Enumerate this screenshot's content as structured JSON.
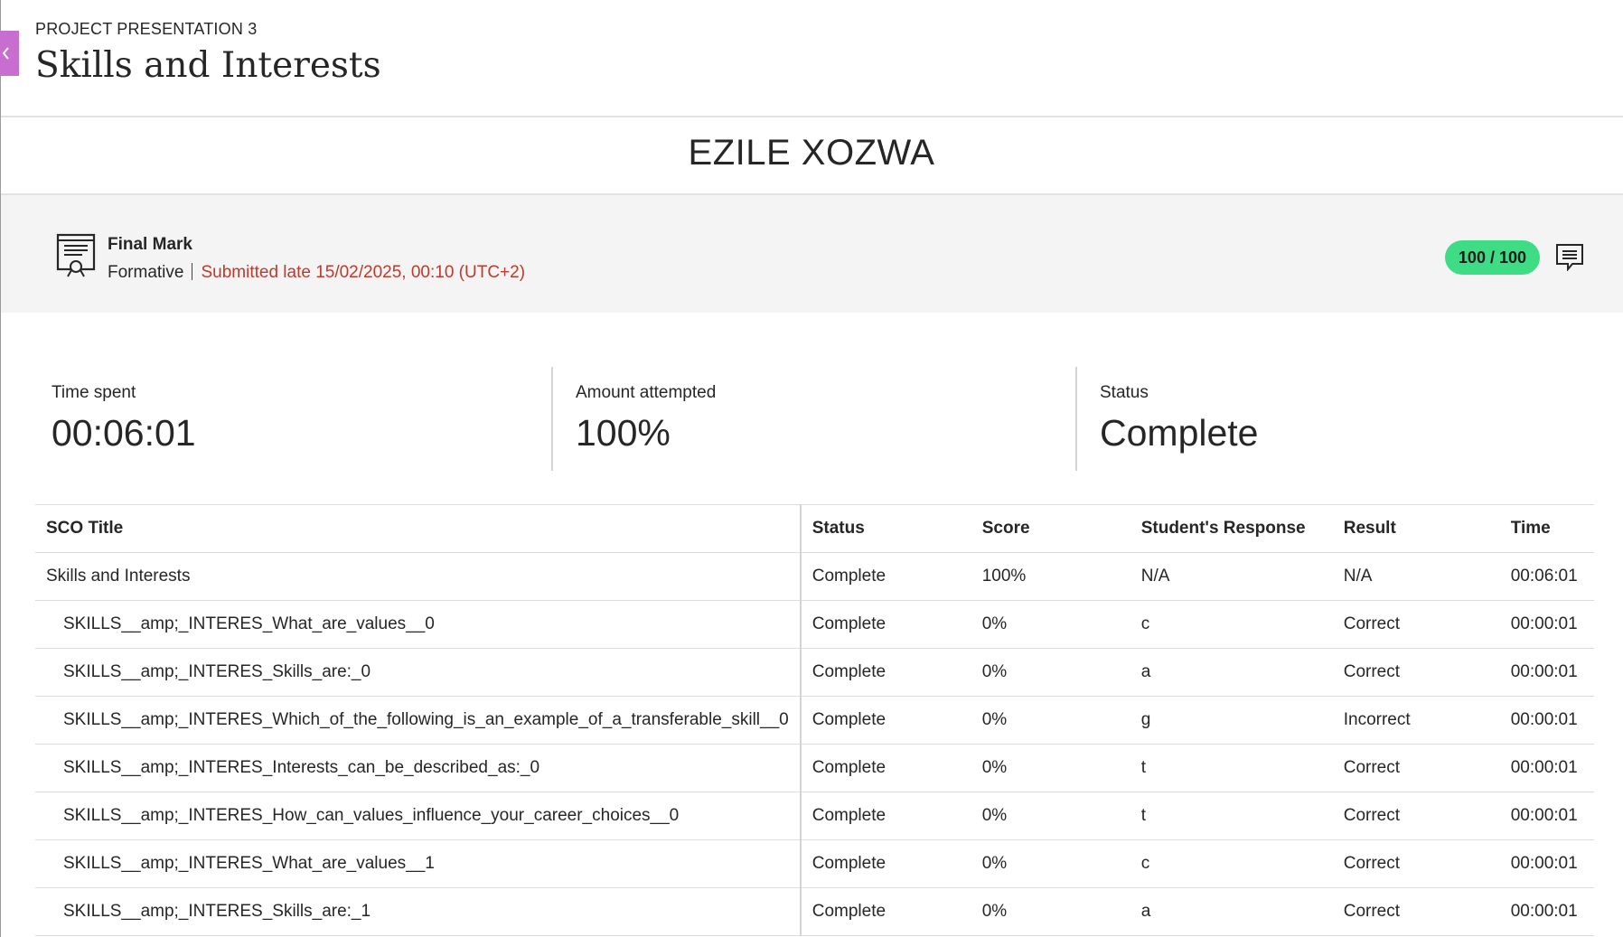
{
  "header": {
    "overline": "PROJECT PRESENTATION 3",
    "title": "Skills and Interests"
  },
  "student": {
    "name": "EZILE XOZWA"
  },
  "final_mark": {
    "label": "Final Mark",
    "type": "Formative",
    "submission": "Submitted late 15/02/2025, 00:10 (UTC+2)",
    "score": "100 / 100",
    "icons": {
      "mark": "certificate-icon",
      "feedback": "feedback-comment-icon"
    },
    "colors": {
      "score_pill": "#3edc85",
      "late_text": "#c0392b"
    }
  },
  "stats": {
    "time_spent": {
      "label": "Time spent",
      "value": "00:06:01"
    },
    "amount_attempted": {
      "label": "Amount attempted",
      "value": "100%"
    },
    "status": {
      "label": "Status",
      "value": "Complete"
    }
  },
  "table": {
    "columns": [
      "SCO Title",
      "Status",
      "Score",
      "Student's Response",
      "Result",
      "Time"
    ],
    "rows": [
      {
        "title": "Skills and Interests",
        "status": "Complete",
        "score": "100%",
        "response": "N/A",
        "result": "N/A",
        "time": "00:06:01",
        "indent": false
      },
      {
        "title": "SKILLS__amp;_INTERES_What_are_values__0",
        "status": "Complete",
        "score": "0%",
        "response": "c",
        "result": "Correct",
        "time": "00:00:01",
        "indent": true
      },
      {
        "title": "SKILLS__amp;_INTERES_Skills_are:_0",
        "status": "Complete",
        "score": "0%",
        "response": "a",
        "result": "Correct",
        "time": "00:00:01",
        "indent": true
      },
      {
        "title": "SKILLS__amp;_INTERES_Which_of_the_following_is_an_example_of_a_transferable_skill__0",
        "status": "Complete",
        "score": "0%",
        "response": "g",
        "result": "Incorrect",
        "time": "00:00:01",
        "indent": true
      },
      {
        "title": "SKILLS__amp;_INTERES_Interests_can_be_described_as:_0",
        "status": "Complete",
        "score": "0%",
        "response": "t",
        "result": "Correct",
        "time": "00:00:01",
        "indent": true
      },
      {
        "title": "SKILLS__amp;_INTERES_How_can_values_influence_your_career_choices__0",
        "status": "Complete",
        "score": "0%",
        "response": "t",
        "result": "Correct",
        "time": "00:00:01",
        "indent": true
      },
      {
        "title": "SKILLS__amp;_INTERES_What_are_values__1",
        "status": "Complete",
        "score": "0%",
        "response": "c",
        "result": "Correct",
        "time": "00:00:01",
        "indent": true
      },
      {
        "title": "SKILLS__amp;_INTERES_Skills_are:_1",
        "status": "Complete",
        "score": "0%",
        "response": "a",
        "result": "Correct",
        "time": "00:00:01",
        "indent": true
      }
    ]
  },
  "close_tab": {
    "icon": "chevron-left-icon",
    "color": "#c86ed0"
  }
}
